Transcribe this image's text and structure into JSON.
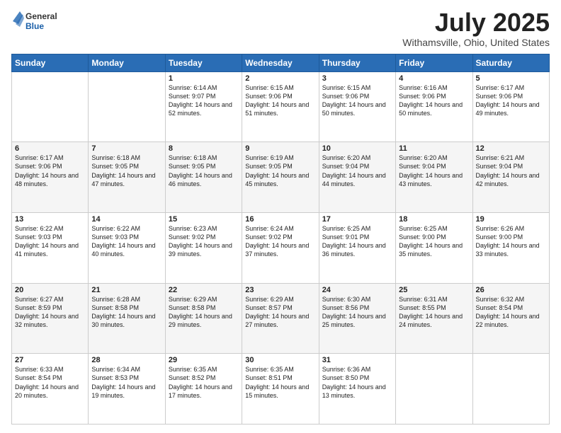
{
  "header": {
    "logo_general": "General",
    "logo_blue": "Blue",
    "title": "July 2025",
    "location": "Withamsville, Ohio, United States"
  },
  "weekdays": [
    "Sunday",
    "Monday",
    "Tuesday",
    "Wednesday",
    "Thursday",
    "Friday",
    "Saturday"
  ],
  "weeks": [
    [
      {
        "day": "",
        "sunrise": "",
        "sunset": "",
        "daylight": ""
      },
      {
        "day": "",
        "sunrise": "",
        "sunset": "",
        "daylight": ""
      },
      {
        "day": "1",
        "sunrise": "Sunrise: 6:14 AM",
        "sunset": "Sunset: 9:07 PM",
        "daylight": "Daylight: 14 hours and 52 minutes."
      },
      {
        "day": "2",
        "sunrise": "Sunrise: 6:15 AM",
        "sunset": "Sunset: 9:06 PM",
        "daylight": "Daylight: 14 hours and 51 minutes."
      },
      {
        "day": "3",
        "sunrise": "Sunrise: 6:15 AM",
        "sunset": "Sunset: 9:06 PM",
        "daylight": "Daylight: 14 hours and 50 minutes."
      },
      {
        "day": "4",
        "sunrise": "Sunrise: 6:16 AM",
        "sunset": "Sunset: 9:06 PM",
        "daylight": "Daylight: 14 hours and 50 minutes."
      },
      {
        "day": "5",
        "sunrise": "Sunrise: 6:17 AM",
        "sunset": "Sunset: 9:06 PM",
        "daylight": "Daylight: 14 hours and 49 minutes."
      }
    ],
    [
      {
        "day": "6",
        "sunrise": "Sunrise: 6:17 AM",
        "sunset": "Sunset: 9:06 PM",
        "daylight": "Daylight: 14 hours and 48 minutes."
      },
      {
        "day": "7",
        "sunrise": "Sunrise: 6:18 AM",
        "sunset": "Sunset: 9:05 PM",
        "daylight": "Daylight: 14 hours and 47 minutes."
      },
      {
        "day": "8",
        "sunrise": "Sunrise: 6:18 AM",
        "sunset": "Sunset: 9:05 PM",
        "daylight": "Daylight: 14 hours and 46 minutes."
      },
      {
        "day": "9",
        "sunrise": "Sunrise: 6:19 AM",
        "sunset": "Sunset: 9:05 PM",
        "daylight": "Daylight: 14 hours and 45 minutes."
      },
      {
        "day": "10",
        "sunrise": "Sunrise: 6:20 AM",
        "sunset": "Sunset: 9:04 PM",
        "daylight": "Daylight: 14 hours and 44 minutes."
      },
      {
        "day": "11",
        "sunrise": "Sunrise: 6:20 AM",
        "sunset": "Sunset: 9:04 PM",
        "daylight": "Daylight: 14 hours and 43 minutes."
      },
      {
        "day": "12",
        "sunrise": "Sunrise: 6:21 AM",
        "sunset": "Sunset: 9:04 PM",
        "daylight": "Daylight: 14 hours and 42 minutes."
      }
    ],
    [
      {
        "day": "13",
        "sunrise": "Sunrise: 6:22 AM",
        "sunset": "Sunset: 9:03 PM",
        "daylight": "Daylight: 14 hours and 41 minutes."
      },
      {
        "day": "14",
        "sunrise": "Sunrise: 6:22 AM",
        "sunset": "Sunset: 9:03 PM",
        "daylight": "Daylight: 14 hours and 40 minutes."
      },
      {
        "day": "15",
        "sunrise": "Sunrise: 6:23 AM",
        "sunset": "Sunset: 9:02 PM",
        "daylight": "Daylight: 14 hours and 39 minutes."
      },
      {
        "day": "16",
        "sunrise": "Sunrise: 6:24 AM",
        "sunset": "Sunset: 9:02 PM",
        "daylight": "Daylight: 14 hours and 37 minutes."
      },
      {
        "day": "17",
        "sunrise": "Sunrise: 6:25 AM",
        "sunset": "Sunset: 9:01 PM",
        "daylight": "Daylight: 14 hours and 36 minutes."
      },
      {
        "day": "18",
        "sunrise": "Sunrise: 6:25 AM",
        "sunset": "Sunset: 9:00 PM",
        "daylight": "Daylight: 14 hours and 35 minutes."
      },
      {
        "day": "19",
        "sunrise": "Sunrise: 6:26 AM",
        "sunset": "Sunset: 9:00 PM",
        "daylight": "Daylight: 14 hours and 33 minutes."
      }
    ],
    [
      {
        "day": "20",
        "sunrise": "Sunrise: 6:27 AM",
        "sunset": "Sunset: 8:59 PM",
        "daylight": "Daylight: 14 hours and 32 minutes."
      },
      {
        "day": "21",
        "sunrise": "Sunrise: 6:28 AM",
        "sunset": "Sunset: 8:58 PM",
        "daylight": "Daylight: 14 hours and 30 minutes."
      },
      {
        "day": "22",
        "sunrise": "Sunrise: 6:29 AM",
        "sunset": "Sunset: 8:58 PM",
        "daylight": "Daylight: 14 hours and 29 minutes."
      },
      {
        "day": "23",
        "sunrise": "Sunrise: 6:29 AM",
        "sunset": "Sunset: 8:57 PM",
        "daylight": "Daylight: 14 hours and 27 minutes."
      },
      {
        "day": "24",
        "sunrise": "Sunrise: 6:30 AM",
        "sunset": "Sunset: 8:56 PM",
        "daylight": "Daylight: 14 hours and 25 minutes."
      },
      {
        "day": "25",
        "sunrise": "Sunrise: 6:31 AM",
        "sunset": "Sunset: 8:55 PM",
        "daylight": "Daylight: 14 hours and 24 minutes."
      },
      {
        "day": "26",
        "sunrise": "Sunrise: 6:32 AM",
        "sunset": "Sunset: 8:54 PM",
        "daylight": "Daylight: 14 hours and 22 minutes."
      }
    ],
    [
      {
        "day": "27",
        "sunrise": "Sunrise: 6:33 AM",
        "sunset": "Sunset: 8:54 PM",
        "daylight": "Daylight: 14 hours and 20 minutes."
      },
      {
        "day": "28",
        "sunrise": "Sunrise: 6:34 AM",
        "sunset": "Sunset: 8:53 PM",
        "daylight": "Daylight: 14 hours and 19 minutes."
      },
      {
        "day": "29",
        "sunrise": "Sunrise: 6:35 AM",
        "sunset": "Sunset: 8:52 PM",
        "daylight": "Daylight: 14 hours and 17 minutes."
      },
      {
        "day": "30",
        "sunrise": "Sunrise: 6:35 AM",
        "sunset": "Sunset: 8:51 PM",
        "daylight": "Daylight: 14 hours and 15 minutes."
      },
      {
        "day": "31",
        "sunrise": "Sunrise: 6:36 AM",
        "sunset": "Sunset: 8:50 PM",
        "daylight": "Daylight: 14 hours and 13 minutes."
      },
      {
        "day": "",
        "sunrise": "",
        "sunset": "",
        "daylight": ""
      },
      {
        "day": "",
        "sunrise": "",
        "sunset": "",
        "daylight": ""
      }
    ]
  ]
}
